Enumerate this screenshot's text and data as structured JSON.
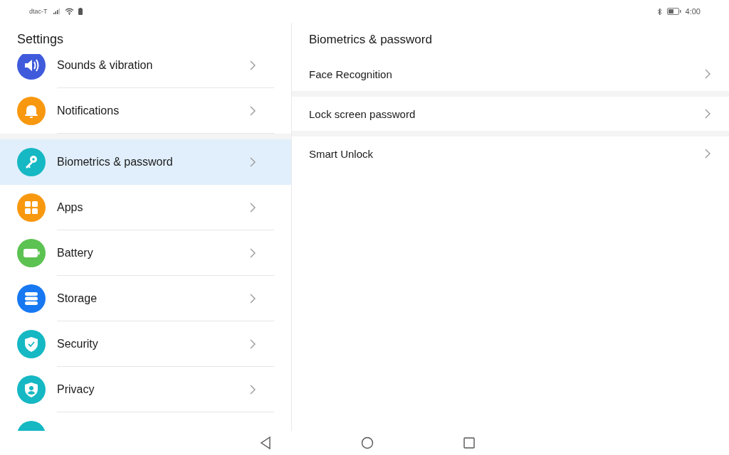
{
  "status_bar": {
    "carrier": "dtac-T",
    "time": "4:00"
  },
  "sidebar": {
    "title": "Settings",
    "groups": [
      {
        "items": [
          {
            "label": "Sounds & vibration",
            "kind": "speaker",
            "color": "#3f5bdc",
            "selected": false
          },
          {
            "label": "Notifications",
            "kind": "bell",
            "color": "#f8980f",
            "selected": false
          }
        ]
      },
      {
        "items": [
          {
            "label": "Biometrics & password",
            "kind": "key",
            "color": "#15b8c3",
            "selected": true
          },
          {
            "label": "Apps",
            "kind": "grid",
            "color": "#f8980f",
            "selected": false
          },
          {
            "label": "Battery",
            "kind": "battery",
            "color": "#5cc251",
            "selected": false
          },
          {
            "label": "Storage",
            "kind": "storage",
            "color": "#1778f2",
            "selected": false
          },
          {
            "label": "Security",
            "kind": "shield",
            "color": "#15b8c3",
            "selected": false
          },
          {
            "label": "Privacy",
            "kind": "privacy",
            "color": "#15b8c3",
            "selected": false
          },
          {
            "kind": "other",
            "color": "#15b8c3",
            "selected": false
          }
        ]
      }
    ]
  },
  "detail": {
    "title": "Biometrics & password",
    "items": [
      {
        "label": "Face Recognition"
      },
      {
        "label": "Lock screen password"
      },
      {
        "label": "Smart Unlock"
      }
    ]
  }
}
